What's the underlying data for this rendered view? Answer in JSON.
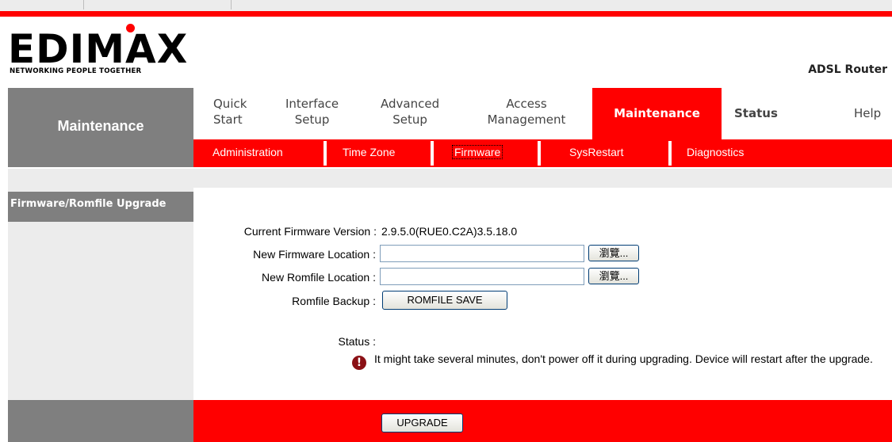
{
  "brand": {
    "logo_text": "EDIMAX",
    "tagline": "NETWORKING PEOPLE TOGETHER",
    "product": "ADSL Router"
  },
  "nav": {
    "section_title": "Maintenance",
    "tabs": [
      {
        "line1": "Quick",
        "line2": "Start"
      },
      {
        "line1": "Interface",
        "line2": "Setup"
      },
      {
        "line1": "Advanced",
        "line2": "Setup"
      },
      {
        "line1": "Access",
        "line2": "Management"
      },
      {
        "line1": "Maintenance",
        "line2": ""
      },
      {
        "line1": "Status",
        "line2": ""
      },
      {
        "line1": "Help",
        "line2": ""
      }
    ],
    "active_tab": "Maintenance",
    "subtabs": [
      "Administration",
      "Time Zone",
      "Firmware",
      "SysRestart",
      "Diagnostics"
    ],
    "active_subtab": "Firmware"
  },
  "page": {
    "section_title": "Firmware/Romfile Upgrade",
    "current_fw_label": "Current Firmware Version :",
    "current_fw_value": "2.9.5.0(RUE0.C2A)3.5.18.0",
    "new_fw_label": "New Firmware Location :",
    "new_fw_value": "",
    "new_rom_label": "New Romfile Location :",
    "new_rom_value": "",
    "browse_label": "瀏覽...",
    "romfile_backup_label": "Romfile Backup :",
    "romfile_save_button": "ROMFILE SAVE",
    "status_label": "Status :",
    "warning_icon": "exclamation-icon",
    "status_message": "It might take several minutes, don't power off it during upgrading. Device will restart after the upgrade.",
    "upgrade_button": "UPGRADE"
  },
  "colors": {
    "accent_red": "#ff0000",
    "panel_gray": "#7f7f7f",
    "light_gray": "#ececec"
  }
}
